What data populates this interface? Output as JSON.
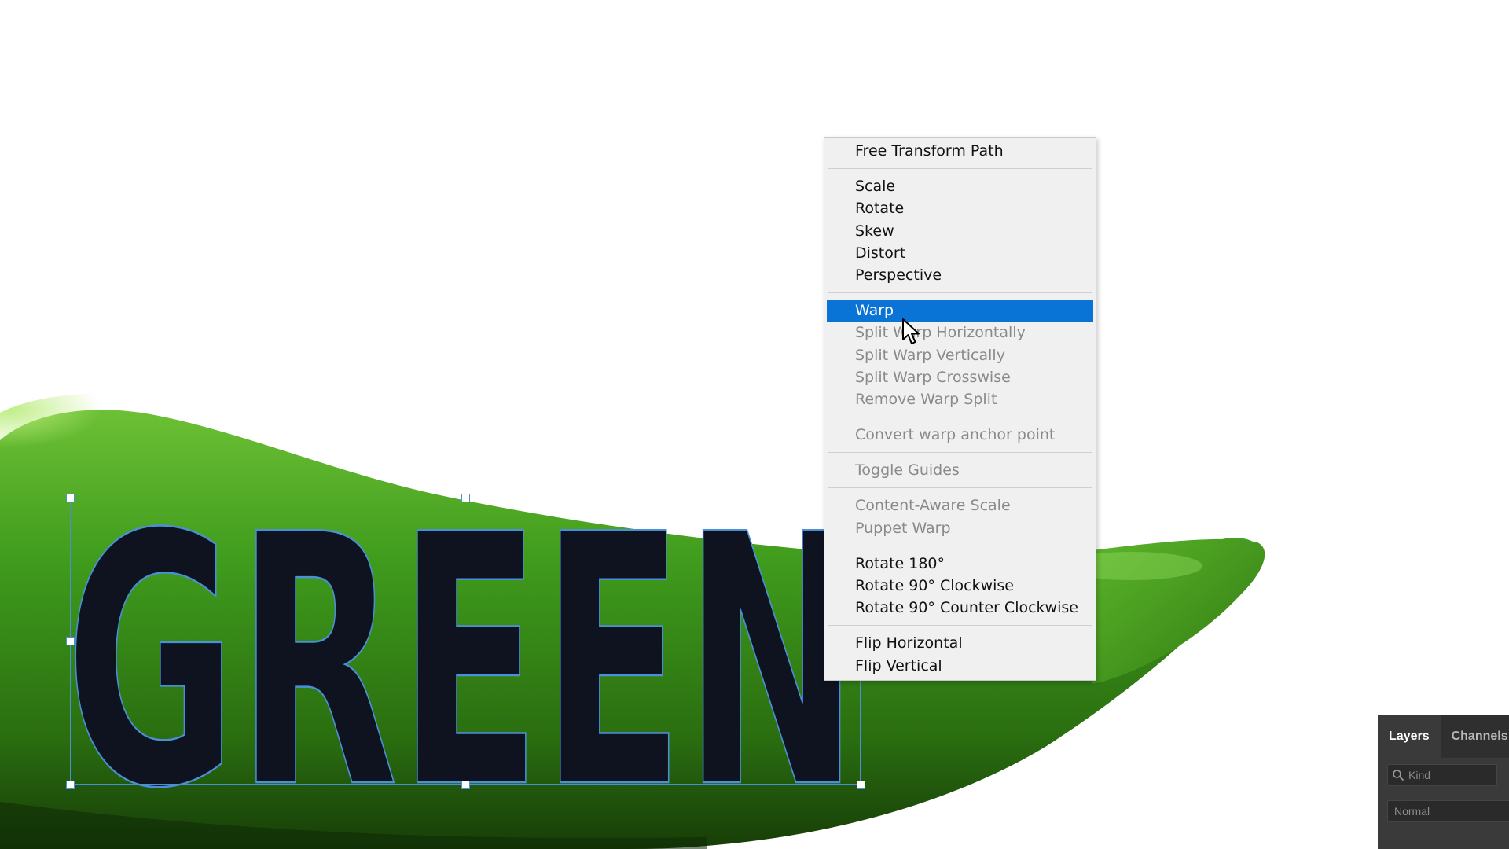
{
  "canvas": {
    "text_layer": "GREEN",
    "colors": {
      "text_fill": "#0f1320",
      "text_outline": "#4a90d9",
      "pepper_green": "#3f9b1c",
      "pepper_dark": "#1f4f0b",
      "background": "#ffffff"
    }
  },
  "context_menu": {
    "groups": [
      [
        {
          "label": "Free Transform Path",
          "enabled": true
        }
      ],
      [
        {
          "label": "Scale",
          "enabled": true
        },
        {
          "label": "Rotate",
          "enabled": true
        },
        {
          "label": "Skew",
          "enabled": true
        },
        {
          "label": "Distort",
          "enabled": true
        },
        {
          "label": "Perspective",
          "enabled": true
        }
      ],
      [
        {
          "label": "Warp",
          "enabled": true,
          "highlighted": true
        },
        {
          "label": "Split Warp Horizontally",
          "enabled": false
        },
        {
          "label": "Split Warp Vertically",
          "enabled": false
        },
        {
          "label": "Split Warp Crosswise",
          "enabled": false
        },
        {
          "label": "Remove Warp Split",
          "enabled": false
        }
      ],
      [
        {
          "label": "Convert warp anchor point",
          "enabled": false
        }
      ],
      [
        {
          "label": "Toggle Guides",
          "enabled": false
        }
      ],
      [
        {
          "label": "Content-Aware Scale",
          "enabled": false
        },
        {
          "label": "Puppet Warp",
          "enabled": false
        }
      ],
      [
        {
          "label": "Rotate 180°",
          "enabled": true
        },
        {
          "label": "Rotate 90° Clockwise",
          "enabled": true
        },
        {
          "label": "Rotate 90° Counter Clockwise",
          "enabled": true
        }
      ],
      [
        {
          "label": "Flip Horizontal",
          "enabled": true
        },
        {
          "label": "Flip Vertical",
          "enabled": true
        }
      ]
    ],
    "highlight_color": "#0a74d6"
  },
  "layers_panel": {
    "tabs": [
      {
        "label": "Layers",
        "active": true
      },
      {
        "label": "Channels",
        "active": false
      }
    ],
    "filter_placeholder": "Kind",
    "blend_mode": "Normal",
    "icons": {
      "filter": "search-icon"
    }
  }
}
